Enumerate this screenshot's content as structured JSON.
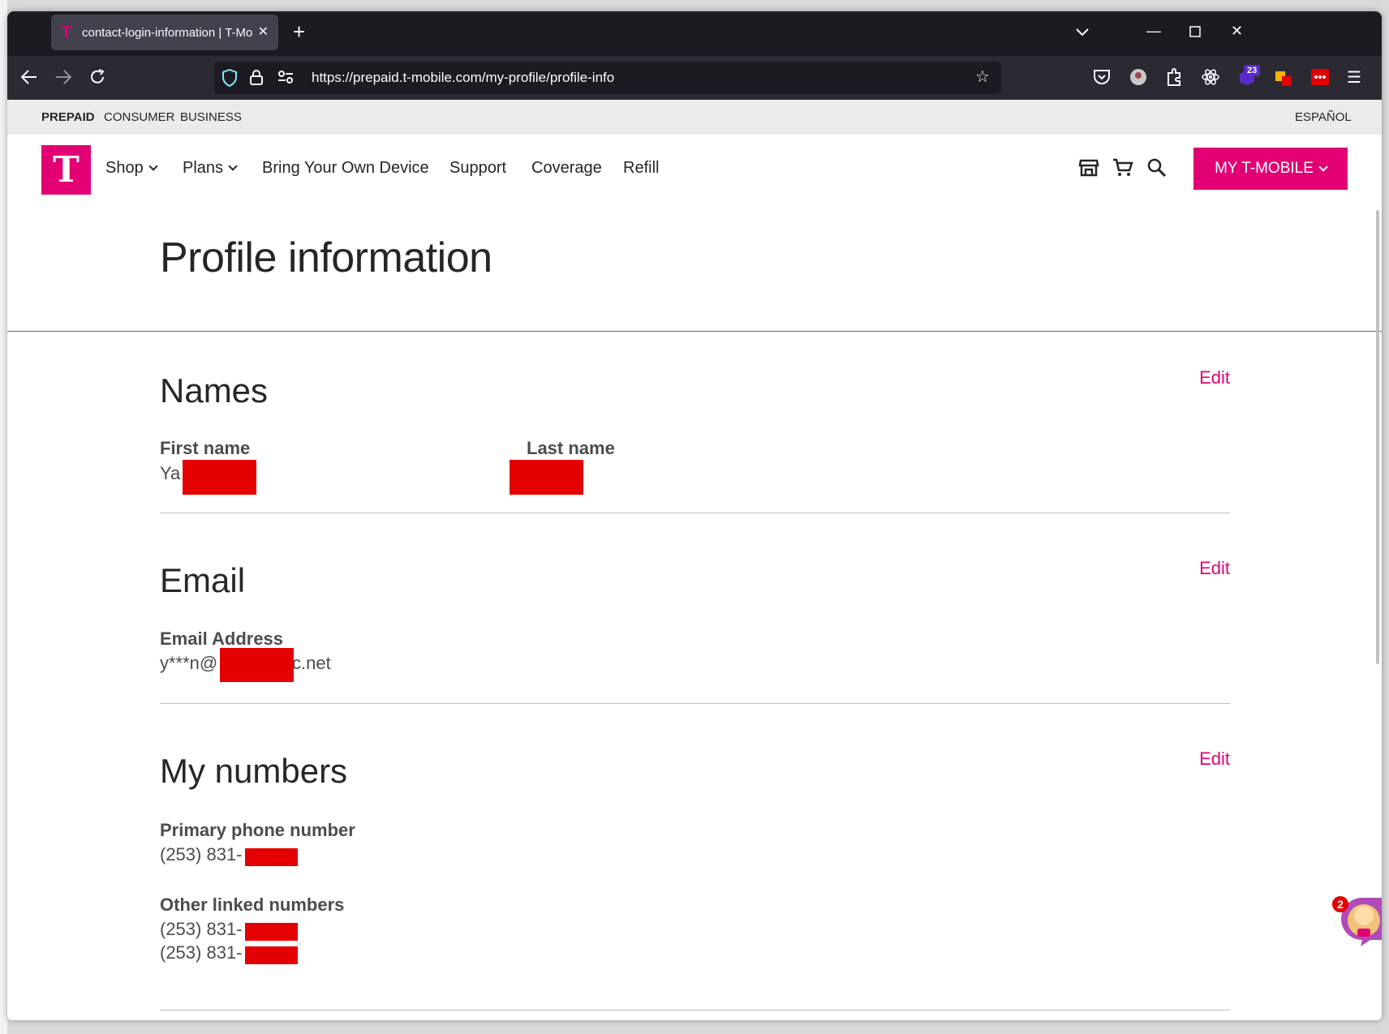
{
  "browser": {
    "tab_title": "contact-login-information | T-Mobile",
    "tab_favicon": "T",
    "url": "https://prepaid.t-mobile.com/my-profile/profile-info",
    "extension_badge": "23"
  },
  "utility_bar": {
    "links": [
      "PREPAID",
      "CONSUMER",
      "BUSINESS"
    ],
    "language": "ESPAÑOL"
  },
  "header": {
    "logo": "T",
    "nav": [
      "Shop",
      "Plans",
      "Bring Your Own Device",
      "Support",
      "Coverage",
      "Refill"
    ],
    "account_button": "MY T-MOBILE"
  },
  "page_title": "Profile information",
  "names": {
    "title": "Names",
    "edit": "Edit",
    "first_name_label": "First name",
    "first_name_value": "Ya",
    "last_name_label": "Last name"
  },
  "email": {
    "title": "Email",
    "edit": "Edit",
    "label": "Email Address",
    "value_prefix": "y***n@",
    "value_suffix": "c.net"
  },
  "numbers": {
    "title": "My numbers",
    "edit": "Edit",
    "primary_label": "Primary phone number",
    "primary_value": "(253) 831-",
    "other_label": "Other linked numbers",
    "other_values": [
      "(253) 831-",
      "(253) 831-"
    ]
  },
  "chat": {
    "badge": "2"
  },
  "colors": {
    "brand": "#e20074",
    "redaction": "#e40000",
    "tab_bar": "#1c1b22",
    "nav_bar": "#2b2a33"
  }
}
